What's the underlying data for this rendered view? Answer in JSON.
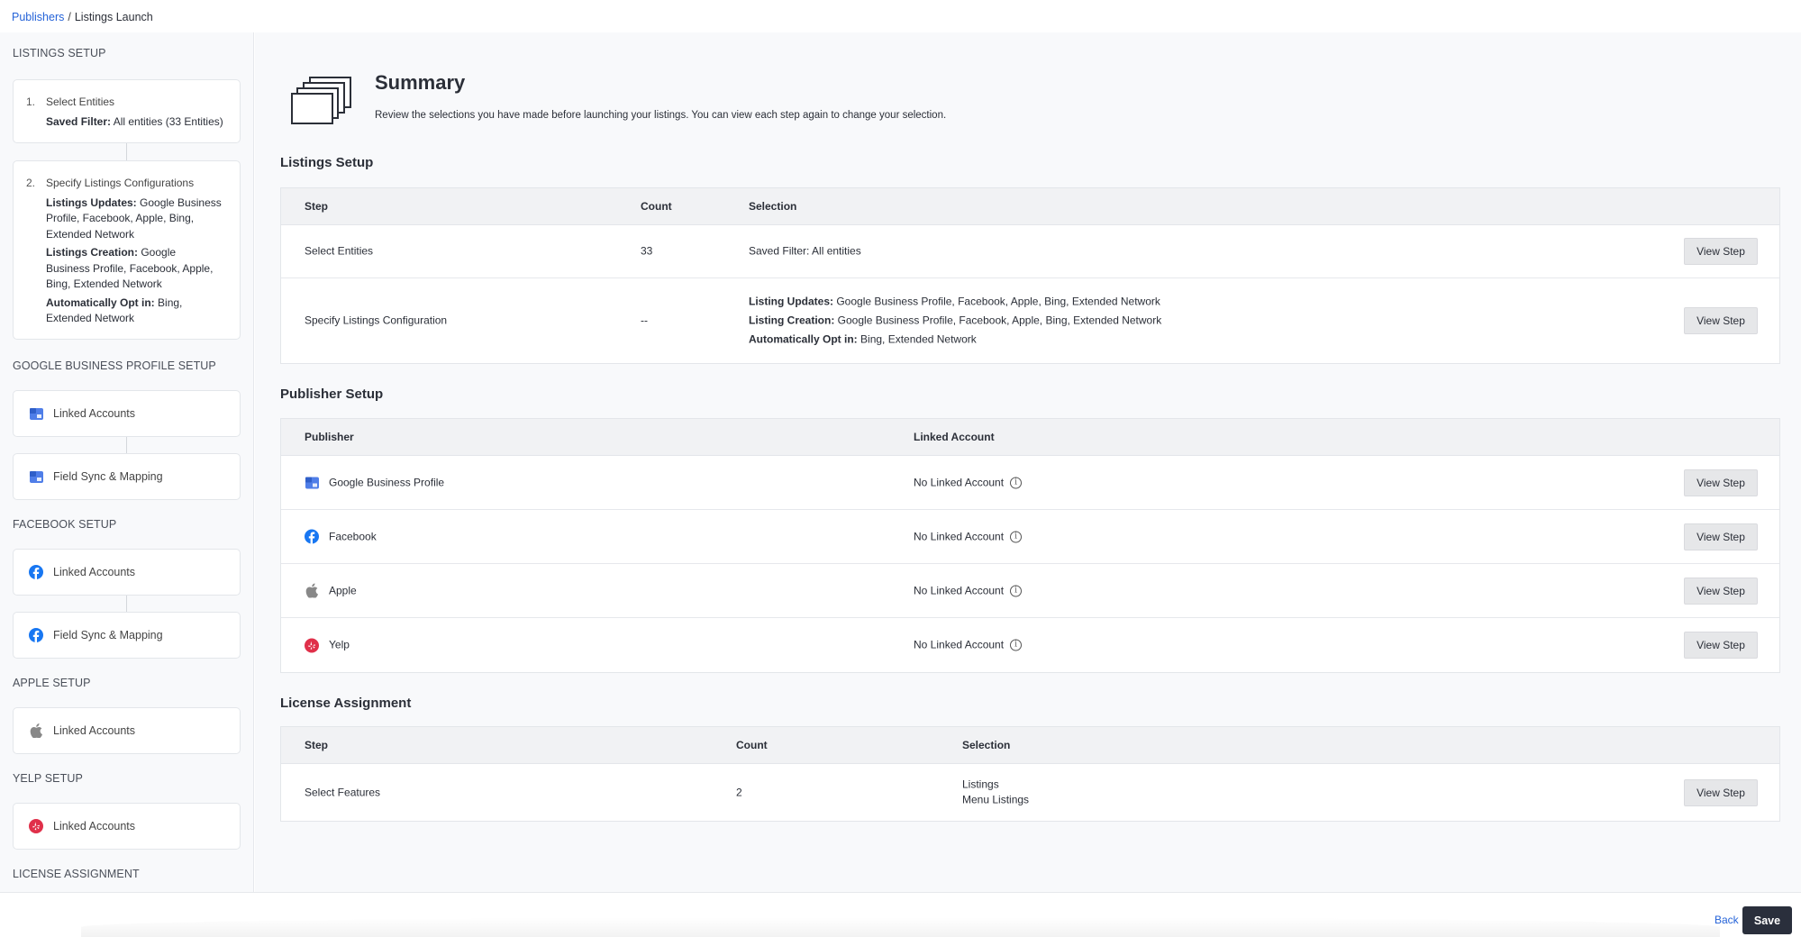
{
  "breadcrumb": {
    "parent": "Publishers",
    "separator": "/",
    "current": "Listings Launch"
  },
  "sidebar": {
    "listings_setup": {
      "heading": "LISTINGS SETUP",
      "step1": {
        "num": "1.",
        "title": "Select Entities",
        "detail_label": "Saved Filter:",
        "detail_value": " All entities (33 Entities)"
      },
      "step2": {
        "num": "2.",
        "title": "Specify Listings Configurations",
        "updates_label": "Listings Updates:",
        "updates_value": " Google Business Profile, Facebook, Apple, Bing, Extended Network",
        "creation_label": "Listings Creation:",
        "creation_value": " Google Business Profile, Facebook, Apple, Bing, Extended Network",
        "optin_label": "Automatically Opt in:",
        "optin_value": " Bing, Extended Network"
      }
    },
    "gbp_setup": {
      "heading": "GOOGLE BUSINESS PROFILE SETUP",
      "linked": "Linked Accounts",
      "field_sync": "Field Sync & Mapping"
    },
    "facebook_setup": {
      "heading": "FACEBOOK SETUP",
      "linked": "Linked Accounts",
      "field_sync": "Field Sync & Mapping"
    },
    "apple_setup": {
      "heading": "APPLE SETUP",
      "linked": "Linked Accounts"
    },
    "yelp_setup": {
      "heading": "YELP SETUP",
      "linked": "Linked Accounts"
    },
    "license_heading": "LICENSE ASSIGNMENT"
  },
  "summary": {
    "title": "Summary",
    "description": "Review the selections you have made before launching your listings. You can view each step again to change your selection."
  },
  "listings_setup_table": {
    "title": "Listings Setup",
    "headers": {
      "step": "Step",
      "count": "Count",
      "selection": "Selection"
    },
    "rows": [
      {
        "step": "Select Entities",
        "count": "33",
        "selection": "Saved Filter: All entities",
        "button": "View Step"
      },
      {
        "step": "Specify Listings Configuration",
        "count": "--",
        "updates_label": "Listing Updates:",
        "updates_value": " Google Business Profile, Facebook, Apple, Bing, Extended Network",
        "creation_label": "Listing Creation:",
        "creation_value": " Google Business Profile, Facebook, Apple, Bing, Extended Network",
        "optin_label": "Automatically Opt in:",
        "optin_value": " Bing, Extended Network",
        "button": "View Step"
      }
    ]
  },
  "publisher_setup_table": {
    "title": "Publisher Setup",
    "headers": {
      "publisher": "Publisher",
      "linked_account": "Linked Account"
    },
    "rows": [
      {
        "publisher": "Google Business Profile",
        "icon": "google-business-profile-icon",
        "linked_account": "No Linked Account",
        "button": "View Step"
      },
      {
        "publisher": "Facebook",
        "icon": "facebook-icon",
        "linked_account": "No Linked Account",
        "button": "View Step"
      },
      {
        "publisher": "Apple",
        "icon": "apple-icon",
        "linked_account": "No Linked Account",
        "button": "View Step"
      },
      {
        "publisher": "Yelp",
        "icon": "yelp-icon",
        "linked_account": "No Linked Account",
        "button": "View Step"
      }
    ]
  },
  "license_table": {
    "title": "License Assignment",
    "headers": {
      "step": "Step",
      "count": "Count",
      "selection": "Selection"
    },
    "rows": [
      {
        "step": "Select Features",
        "count": "2",
        "selection_1": "Listings",
        "selection_2": "Menu Listings",
        "button": "View Step"
      }
    ]
  },
  "footer": {
    "back": "Back",
    "save": "Save"
  },
  "colors": {
    "link": "#2563d8",
    "save_button": "#2a2f3c",
    "gbp_blue": "#4f7ee8",
    "facebook_blue": "#1877f2",
    "apple_gray": "#888888",
    "yelp_red": "#e0304a"
  }
}
